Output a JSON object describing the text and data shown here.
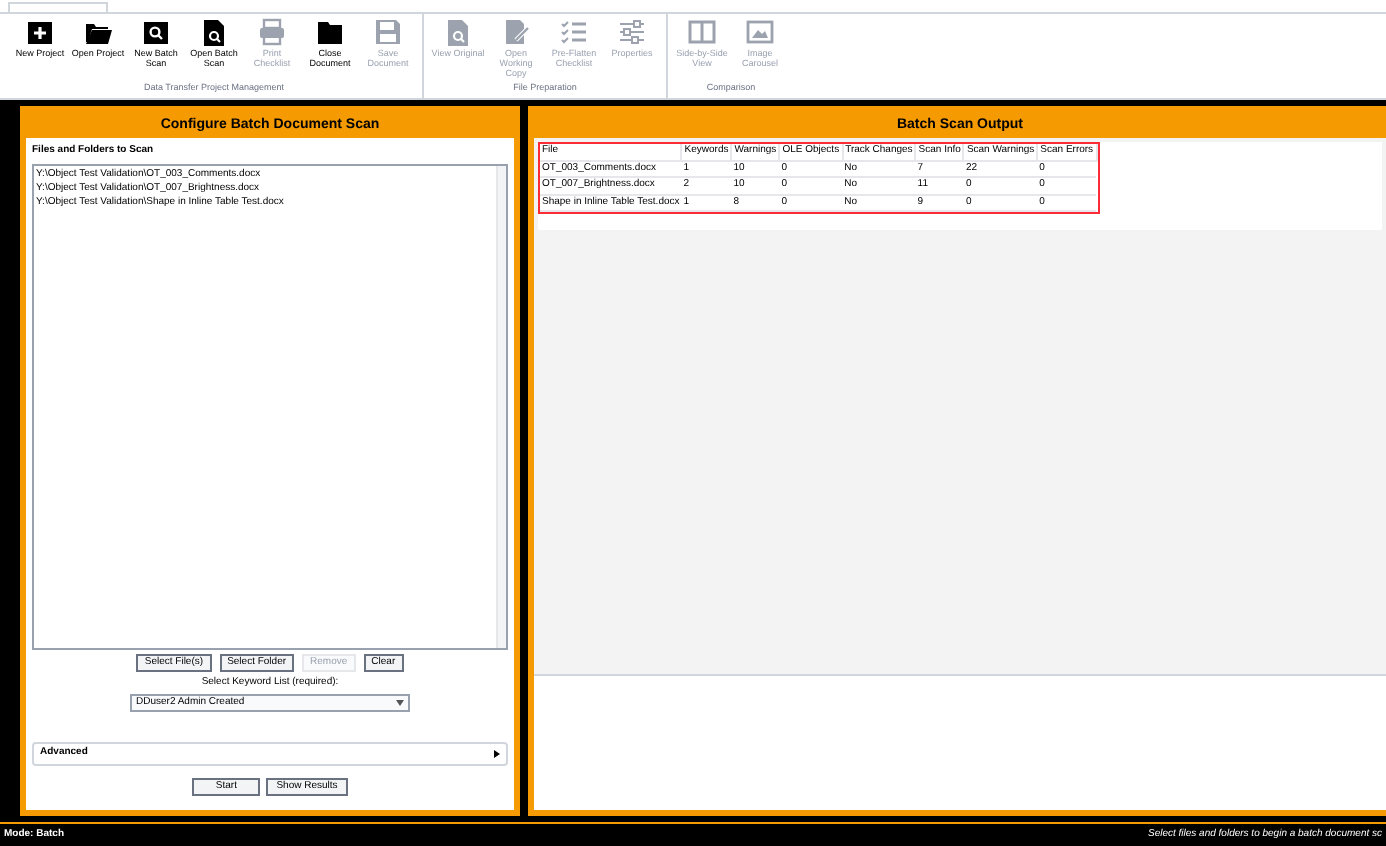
{
  "ribbon": {
    "groups": [
      {
        "label": "Data Transfer Project Management",
        "buttons": [
          {
            "label": "New Project",
            "kind": "new",
            "disabled": false
          },
          {
            "label": "Open Project",
            "kind": "folder",
            "disabled": false
          },
          {
            "label": "New Batch Scan",
            "kind": "scan",
            "disabled": false
          },
          {
            "label": "Open Batch Scan",
            "kind": "scandoc",
            "disabled": false
          },
          {
            "label": "Print Checklist",
            "kind": "print",
            "disabled": true
          },
          {
            "label": "Close Document",
            "kind": "closefolder",
            "disabled": false
          },
          {
            "label": "Save Document",
            "kind": "save",
            "disabled": true
          }
        ]
      },
      {
        "label": "File Preparation",
        "buttons": [
          {
            "label": "View Original",
            "kind": "scandoc",
            "disabled": true
          },
          {
            "label": "Open Working Copy",
            "kind": "edit",
            "disabled": true
          },
          {
            "label": "Pre-Flatten Checklist",
            "kind": "list",
            "disabled": true
          },
          {
            "label": "Properties",
            "kind": "sliders",
            "disabled": true
          }
        ]
      },
      {
        "label": "Comparison",
        "buttons": [
          {
            "label": "Side-by-Side View",
            "kind": "columns",
            "disabled": true
          },
          {
            "label": "Image Carousel",
            "kind": "image",
            "disabled": true
          }
        ]
      }
    ]
  },
  "config_panel": {
    "title": "Configure Batch Document Scan",
    "list_label": "Files and Folders to Scan",
    "files": [
      "Y:\\Object Test Validation\\OT_003_Comments.docx",
      "Y:\\Object Test Validation\\OT_007_Brightness.docx",
      "Y:\\Object Test Validation\\Shape in Inline Table Test.docx"
    ],
    "file_buttons": [
      {
        "label": "Select File(s)",
        "disabled": false
      },
      {
        "label": "Select Folder",
        "disabled": false
      },
      {
        "label": "Remove",
        "disabled": true
      },
      {
        "label": "Clear",
        "disabled": false
      }
    ],
    "keyword_label": "Select Keyword List (required):",
    "keyword_value": "DDuser2 Admin Created",
    "advanced": {
      "label": "Advanced",
      "expanded": false
    },
    "action_buttons": [
      {
        "label": "Start"
      },
      {
        "label": "Show Results"
      }
    ]
  },
  "output_panel": {
    "title": "Batch Scan Output",
    "table": {
      "columns": [
        "File",
        "Keywords",
        "Warnings",
        "OLE Objects",
        "Track Changes",
        "Scan Info",
        "Scan Warnings",
        "Scan Errors"
      ],
      "rows": [
        [
          "OT_003_Comments.docx",
          "1",
          "10",
          "0",
          "No",
          "7",
          "22",
          "0"
        ],
        [
          "OT_007_Brightness.docx",
          "2",
          "10",
          "0",
          "No",
          "11",
          "0",
          "0"
        ],
        [
          "Shape in Inline Table Test.docx",
          "1",
          "8",
          "0",
          "No",
          "9",
          "0",
          "0"
        ]
      ]
    }
  },
  "status_bar": {
    "mode": "Mode: Batch",
    "message": "Select files and folders to begin a batch document sc"
  }
}
